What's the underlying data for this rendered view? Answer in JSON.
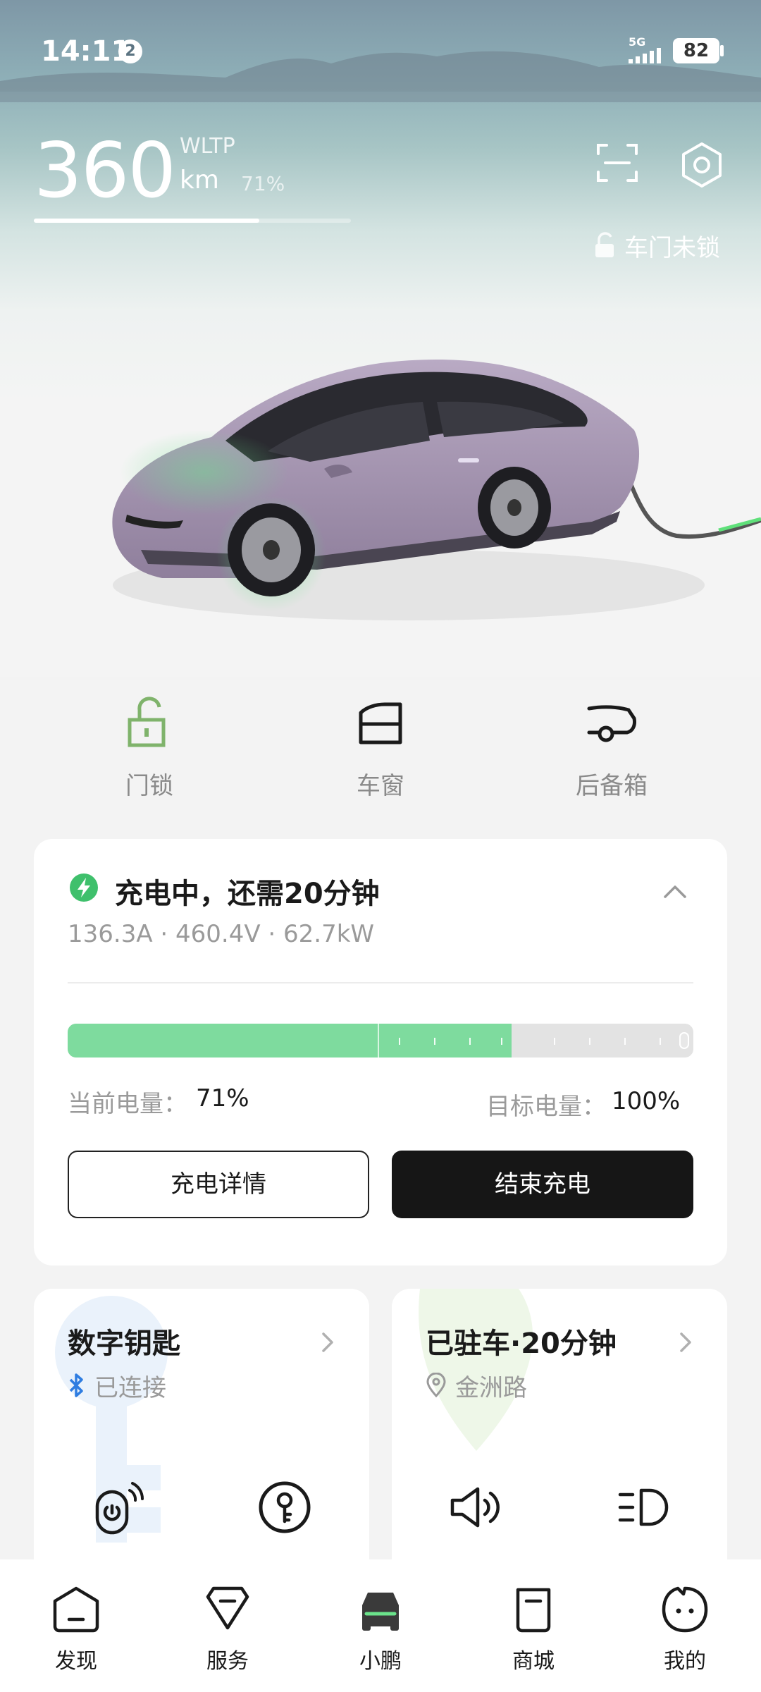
{
  "status_bar": {
    "time": "14:11",
    "notification_count": "2",
    "network": "5G",
    "battery": "82"
  },
  "range": {
    "value": "360",
    "standard": "WLTP",
    "unit": "km",
    "percent": "71%",
    "fill_fraction": 0.71
  },
  "door_status": "车门未锁",
  "quick_controls": [
    {
      "label": "门锁",
      "icon": "unlock-icon"
    },
    {
      "label": "车窗",
      "icon": "window-icon"
    },
    {
      "label": "后备箱",
      "icon": "trunk-icon"
    }
  ],
  "charging": {
    "title": "充电中，还需20分钟",
    "metrics": "136.3A · 460.4V · 62.7kW",
    "current_label": "当前电量：",
    "current_value": "71%",
    "current_fraction": 0.71,
    "target_label": "目标电量：",
    "target_value": "100%",
    "details_button": "充电详情",
    "stop_button": "结束充电"
  },
  "digital_key": {
    "title": "数字钥匙",
    "status": "已连接"
  },
  "parking": {
    "title": "已驻车·20分钟",
    "location": "金洲路"
  },
  "nav": [
    {
      "label": "发现",
      "icon": "discover-icon"
    },
    {
      "label": "服务",
      "icon": "service-icon"
    },
    {
      "label": "小鹏",
      "icon": "car-icon"
    },
    {
      "label": "商城",
      "icon": "mall-icon"
    },
    {
      "label": "我的",
      "icon": "profile-icon"
    }
  ],
  "colors": {
    "accent_green": "#7edb9e",
    "charge_green": "#3fc06c",
    "unlock_green": "#7fb36b",
    "bluetooth_blue": "#2f7de1"
  }
}
